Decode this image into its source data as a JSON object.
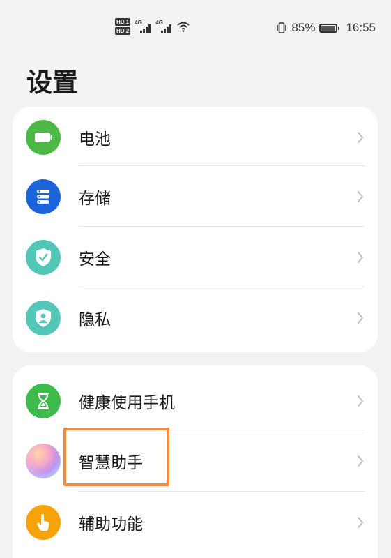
{
  "status_bar": {
    "sim1_tag": "HD 1",
    "sim2_tag": "HD 2",
    "net1": "4G",
    "net2": "4G",
    "battery_percent": "85%",
    "time": "16:55"
  },
  "page": {
    "title": "设置"
  },
  "group1": {
    "items": [
      {
        "label": "电池",
        "icon": "battery-icon",
        "color": "#4cb944"
      },
      {
        "label": "存储",
        "icon": "storage-icon",
        "color": "#1c62d8"
      },
      {
        "label": "安全",
        "icon": "shield-check-icon",
        "color": "#52c7b8"
      },
      {
        "label": "隐私",
        "icon": "privacy-shield-icon",
        "color": "#52c7b8"
      }
    ]
  },
  "group2": {
    "items": [
      {
        "label": "健康使用手机",
        "icon": "hourglass-icon",
        "color": "#3dbb4b"
      },
      {
        "label": "智慧助手",
        "icon": "assistant-orb-icon",
        "color": "#e58ac4"
      },
      {
        "label": "辅助功能",
        "icon": "hand-tap-icon",
        "color": "#f6a20b"
      }
    ]
  },
  "highlight": {
    "color": "#f58a3c",
    "target": "智慧助手"
  }
}
